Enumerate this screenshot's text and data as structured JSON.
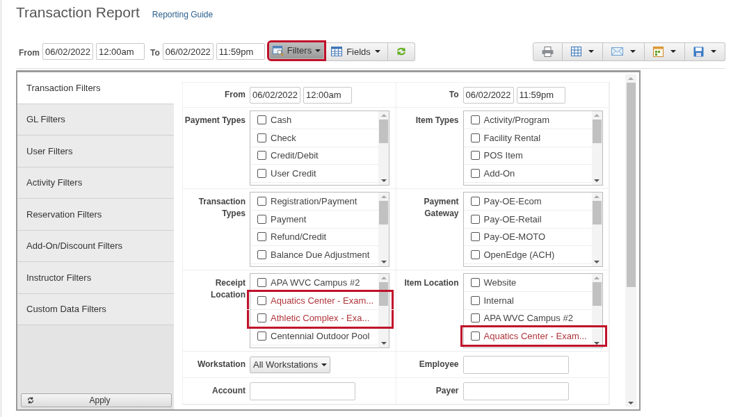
{
  "page": {
    "title": "Transaction Report",
    "guide_link": "Reporting Guide"
  },
  "toolbar": {
    "from_label": "From",
    "from_date": "06/02/2022",
    "from_time": "12:00am",
    "to_label": "To",
    "to_date": "06/02/2022",
    "to_time": "11:59pm",
    "buttons": [
      {
        "kind": "filters",
        "label": "Filters",
        "highlighted": true
      },
      {
        "kind": "fields",
        "label": "Fields",
        "highlighted": false
      },
      {
        "kind": "refresh",
        "highlighted": false
      }
    ],
    "actions": [
      {
        "kind": "print",
        "dropdown": false
      },
      {
        "kind": "grid",
        "dropdown": true
      },
      {
        "kind": "email",
        "dropdown": true
      },
      {
        "kind": "schedule",
        "dropdown": true
      },
      {
        "kind": "save",
        "dropdown": true
      }
    ]
  },
  "filters_panel": {
    "tabs": [
      {
        "label": "Transaction Filters",
        "selected": true
      },
      {
        "label": "GL Filters",
        "selected": false
      },
      {
        "label": "User Filters",
        "selected": false
      },
      {
        "label": "Activity Filters",
        "selected": false
      },
      {
        "label": "Reservation Filters",
        "selected": false
      },
      {
        "label": "Add-On/Discount Filters",
        "selected": false
      },
      {
        "label": "Instructor Filters",
        "selected": false
      },
      {
        "label": "Custom Data Filters",
        "selected": false
      }
    ],
    "apply_button": "Apply",
    "range": [
      {
        "label": "From",
        "date": "06/02/2022",
        "time": "12:00am"
      },
      {
        "label": "To",
        "date": "06/02/2022",
        "time": "11:59pm"
      }
    ],
    "lists": [
      {
        "label": "Payment Types",
        "items": [
          {
            "label": "Cash",
            "checked": false,
            "highlighted": false
          },
          {
            "label": "Check",
            "checked": false,
            "highlighted": false
          },
          {
            "label": "Credit/Debit",
            "checked": false,
            "highlighted": false
          },
          {
            "label": "User Credit",
            "checked": false,
            "highlighted": false
          }
        ]
      },
      {
        "label": "Item Types",
        "items": [
          {
            "label": "Activity/Program",
            "checked": false,
            "highlighted": false
          },
          {
            "label": "Facility Rental",
            "checked": false,
            "highlighted": false
          },
          {
            "label": "POS Item",
            "checked": false,
            "highlighted": false
          },
          {
            "label": "Add-On",
            "checked": false,
            "highlighted": false
          }
        ]
      },
      {
        "label": "Transaction Types",
        "items": [
          {
            "label": "Registration/Payment",
            "checked": false,
            "highlighted": false
          },
          {
            "label": "Payment",
            "checked": false,
            "highlighted": false
          },
          {
            "label": "Refund/Credit",
            "checked": false,
            "highlighted": false
          },
          {
            "label": "Balance Due Adjustment",
            "checked": false,
            "highlighted": false
          }
        ]
      },
      {
        "label": "Payment Gateway",
        "items": [
          {
            "label": "Pay-OE-Ecom",
            "checked": false,
            "highlighted": false
          },
          {
            "label": "Pay-OE-Retail",
            "checked": false,
            "highlighted": false
          },
          {
            "label": "Pay-OE-MOTO",
            "checked": false,
            "highlighted": false
          },
          {
            "label": "OpenEdge (ACH)",
            "checked": false,
            "highlighted": false
          }
        ]
      },
      {
        "label": "Receipt Location",
        "items": [
          {
            "label": "APA WVC Campus #2",
            "checked": false,
            "highlighted": false
          },
          {
            "label": "Aquatics Center - Exam...",
            "checked": false,
            "highlighted": true
          },
          {
            "label": "Athletic Complex - Exa...",
            "checked": false,
            "highlighted": true
          },
          {
            "label": "Centennial Outdoor Pool",
            "checked": false,
            "highlighted": false
          }
        ]
      },
      {
        "label": "Item Location",
        "items": [
          {
            "label": "Website",
            "checked": false,
            "highlighted": false
          },
          {
            "label": "Internal",
            "checked": false,
            "highlighted": false
          },
          {
            "label": "APA WVC Campus #2",
            "checked": false,
            "highlighted": false
          },
          {
            "label": "Aquatics Center - Exam...",
            "checked": false,
            "highlighted": true
          }
        ]
      }
    ],
    "fields": [
      {
        "kind": "select",
        "label": "Workstation",
        "value": "All Workstations"
      },
      {
        "kind": "text",
        "label": "Employee"
      },
      {
        "kind": "text",
        "label": "Account"
      },
      {
        "kind": "text",
        "label": "Payer"
      }
    ]
  }
}
